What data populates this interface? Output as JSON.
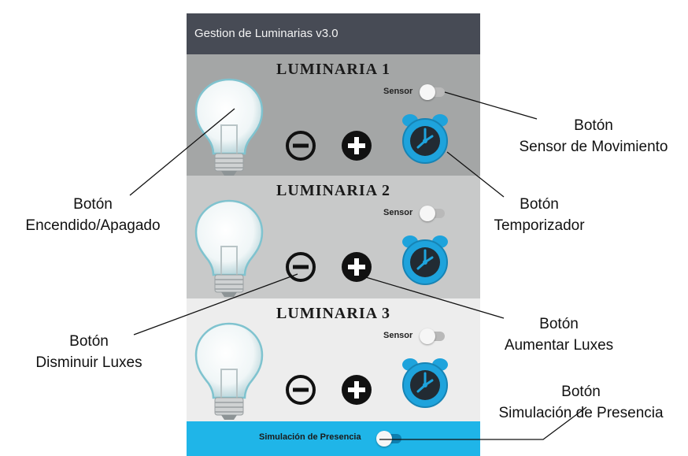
{
  "app": {
    "title": "Gestion de Luminarias v3.0"
  },
  "panels": [
    {
      "title": "LUMINARIA 1",
      "sensor_label": "Sensor"
    },
    {
      "title": "LUMINARIA 2",
      "sensor_label": "Sensor"
    },
    {
      "title": "LUMINARIA 3",
      "sensor_label": "Sensor"
    }
  ],
  "bottom_bar": {
    "label": "Simulación de Presencia"
  },
  "icons": [
    "light-bulb-icon",
    "minus-circle-icon",
    "plus-circle-icon",
    "alarm-clock-icon"
  ],
  "callouts": {
    "sensor": {
      "line1": "Botón",
      "line2": "Sensor de Movimiento"
    },
    "power": {
      "line1": "Botón",
      "line2": "Encendido/Apagado"
    },
    "timer": {
      "line1": "Botón",
      "line2": "Temporizador"
    },
    "decrease": {
      "line1": "Botón",
      "line2": "Disminuir Luxes"
    },
    "increase": {
      "line1": "Botón",
      "line2": "Aumentar Luxes"
    },
    "presence": {
      "line1": "Botón",
      "line2": "Simulación de Presencia"
    }
  },
  "colors": {
    "appbar": "#474b55",
    "panel1": "#a4a6a6",
    "panel2": "#c8c9c9",
    "panel3": "#ededed",
    "bottom_bar": "#1fb5e8",
    "alarm": "#1ea3dc"
  }
}
